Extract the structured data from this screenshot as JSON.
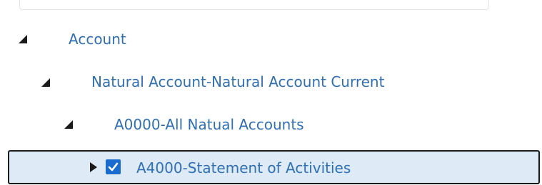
{
  "tree": {
    "nodes": [
      {
        "label": "Account",
        "expanded": true,
        "level": 0
      },
      {
        "label": "Natural Account-Natural Account Current",
        "expanded": true,
        "level": 1
      },
      {
        "label": "A0000-All Natual Accounts",
        "expanded": true,
        "level": 2
      },
      {
        "label": "A4000-Statement of Activities",
        "expanded": false,
        "level": 3,
        "checked": true,
        "selected": true
      }
    ]
  },
  "colors": {
    "link_text": "#2f6fb2",
    "selected_bg": "#deebf7",
    "checkbox": "#1a6bd0"
  }
}
